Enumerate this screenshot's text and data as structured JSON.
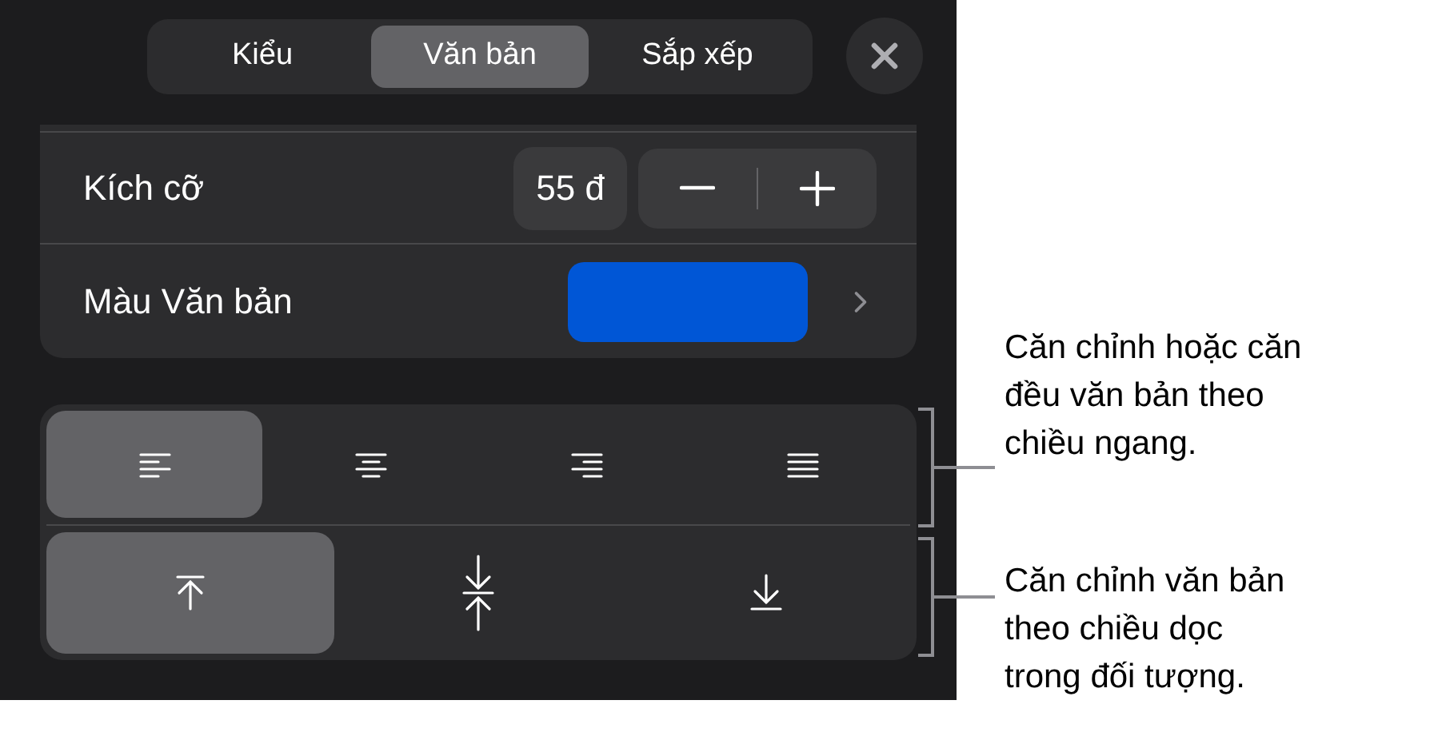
{
  "tabs": [
    {
      "label": "Kiểu",
      "selected": false
    },
    {
      "label": "Văn bản",
      "selected": true
    },
    {
      "label": "Sắp xếp",
      "selected": false
    }
  ],
  "size_row": {
    "label": "Kích cỡ",
    "value": "55 đ"
  },
  "color_row": {
    "label": "Màu Văn bản",
    "color": "#0056d6"
  },
  "horizontal_alignment": [
    {
      "kind": "left",
      "selected": true
    },
    {
      "kind": "center",
      "selected": false
    },
    {
      "kind": "right",
      "selected": false
    },
    {
      "kind": "justify",
      "selected": false
    }
  ],
  "vertical_alignment": [
    {
      "kind": "top",
      "selected": true
    },
    {
      "kind": "middle",
      "selected": false
    },
    {
      "kind": "bottom",
      "selected": false
    }
  ],
  "callouts": [
    {
      "lines": [
        "Căn chỉnh hoặc căn",
        "đều văn bản theo",
        "chiều ngang."
      ]
    },
    {
      "lines": [
        "Căn chỉnh văn bản",
        "theo chiều dọc",
        "trong đối tượng."
      ]
    }
  ]
}
